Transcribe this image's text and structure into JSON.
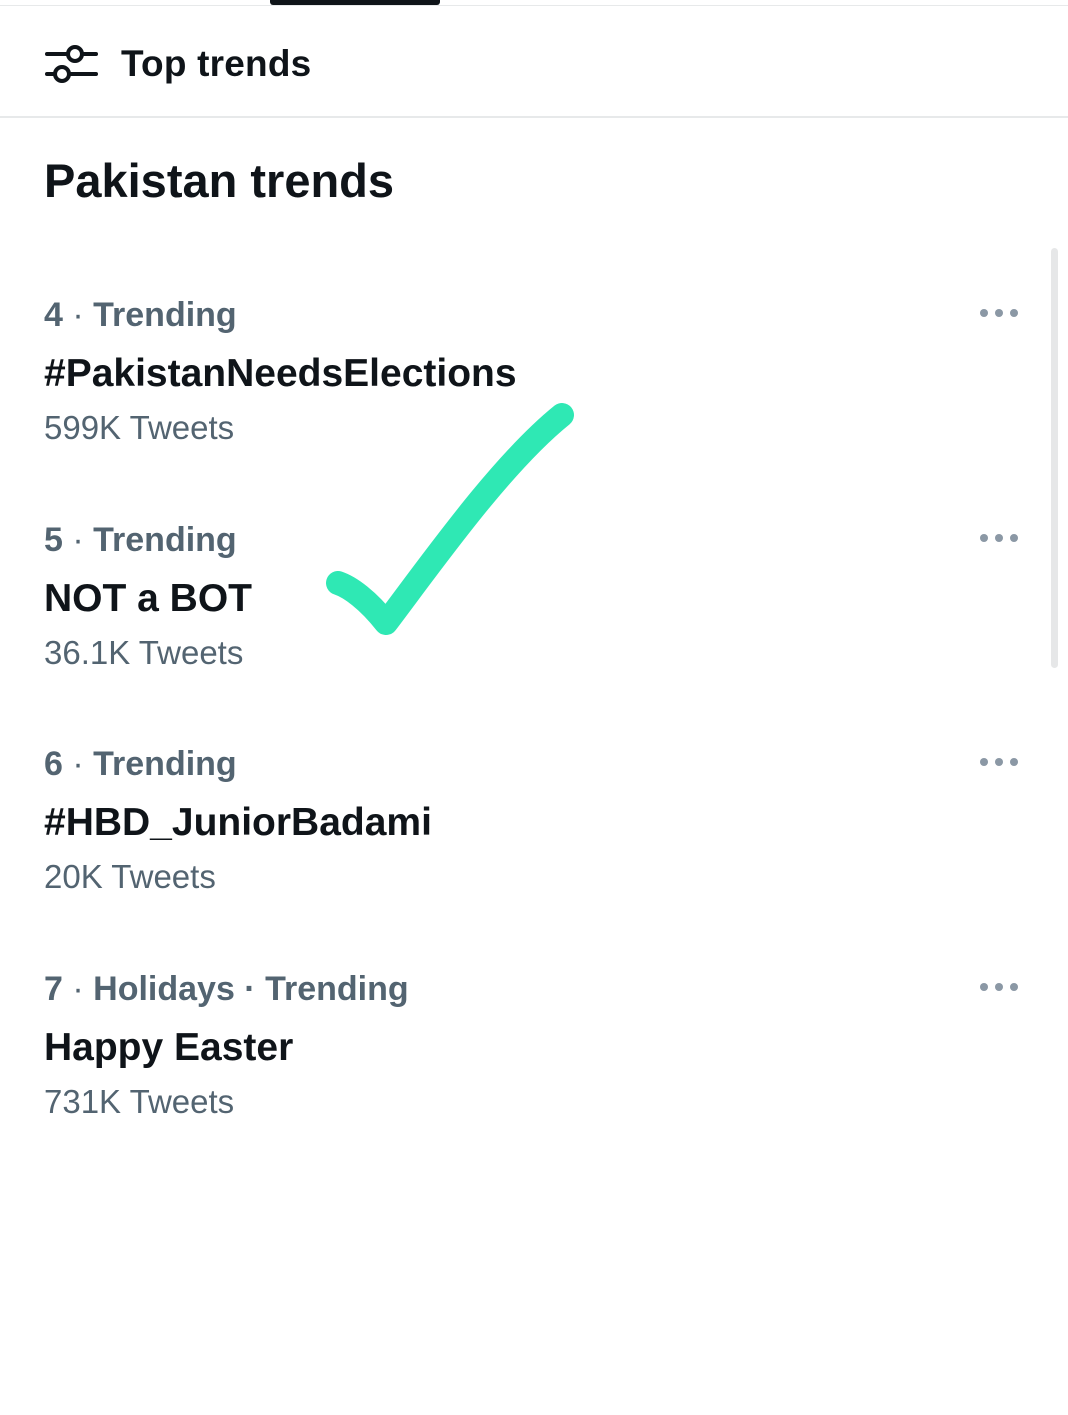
{
  "header": {
    "title": "Top trends",
    "icon": "sliders-icon"
  },
  "section": {
    "title": "Pakistan trends"
  },
  "trends": [
    {
      "rank": "4",
      "category": "Trending",
      "name": "#PakistanNeedsElections",
      "count": "599K Tweets"
    },
    {
      "rank": "5",
      "category": "Trending",
      "name": "NOT a BOT",
      "count": "36.1K Tweets"
    },
    {
      "rank": "6",
      "category": "Trending",
      "name": "#HBD_JuniorBadami",
      "count": "20K Tweets"
    },
    {
      "rank": "7",
      "category": "Holidays · Trending",
      "name": "Happy Easter",
      "count": "731K Tweets"
    }
  ],
  "colors": {
    "text_primary": "#0f1419",
    "text_secondary": "#536471",
    "checkmark": "#2fe8b4",
    "divider": "#e7e9ea"
  },
  "annotation": {
    "icon": "checkmark-icon"
  }
}
